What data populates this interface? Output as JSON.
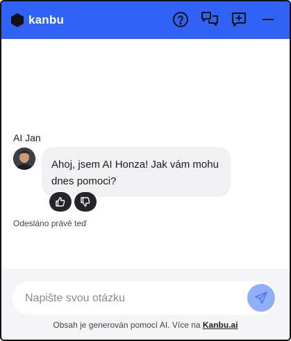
{
  "header": {
    "brand": "kanbu",
    "icons": [
      "help-icon",
      "chat-bubbles-icon",
      "new-chat-icon",
      "minimize-icon"
    ]
  },
  "chat": {
    "sender_name": "AI Jan",
    "message": "Ahoj, jsem AI Honza! Jak vám mohu dnes pomoci?",
    "status": "Odesláno právě teď"
  },
  "input": {
    "placeholder": "Napište svou otázku"
  },
  "footer": {
    "disclaimer_text": "Obsah je generován pomocí AI. Více na ",
    "link_text": "Kanbu.ai"
  },
  "colors": {
    "header_bg": "#2f62f5",
    "send_button": "#8fb0f7",
    "bubble_bg": "#f1f1f3",
    "reaction_bg": "#23252a"
  }
}
